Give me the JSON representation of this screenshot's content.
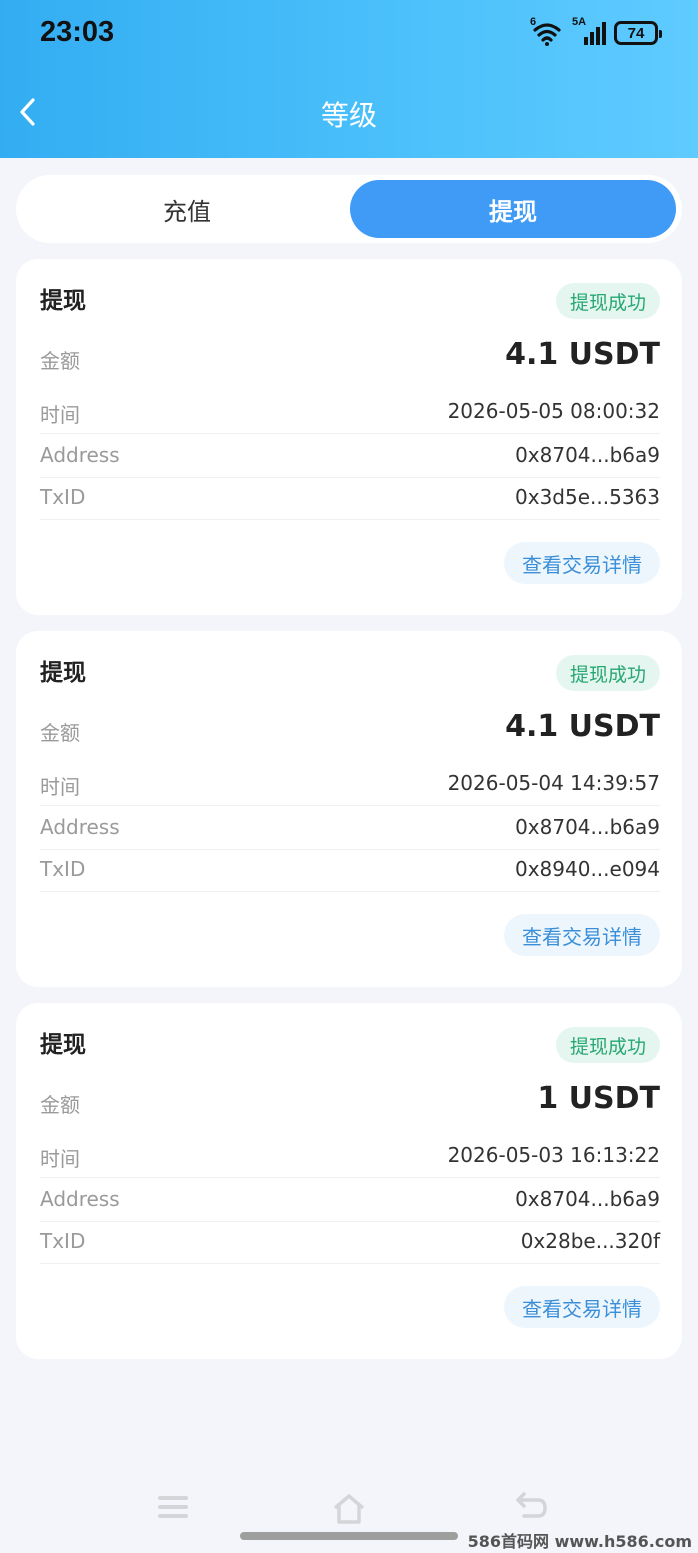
{
  "status_bar": {
    "time": "23:03",
    "wifi_badge": "6",
    "signal_badge": "5A",
    "battery": "74"
  },
  "header": {
    "title": "等级"
  },
  "tabs": [
    {
      "label": "充值",
      "active": false
    },
    {
      "label": "提现",
      "active": true
    }
  ],
  "labels": {
    "amount": "金额",
    "time": "时间",
    "address": "Address",
    "txid": "TxID",
    "details_button": "查看交易详情"
  },
  "records": [
    {
      "type": "提现",
      "status": "提现成功",
      "amount": "4.1 USDT",
      "time": "2026-05-05 08:00:32",
      "address": "0x8704...b6a9",
      "txid": "0x3d5e...5363"
    },
    {
      "type": "提现",
      "status": "提现成功",
      "amount": "4.1 USDT",
      "time": "2026-05-04 14:39:57",
      "address": "0x8704...b6a9",
      "txid": "0x8940...e094"
    },
    {
      "type": "提现",
      "status": "提现成功",
      "amount": "1 USDT",
      "time": "2026-05-03 16:13:22",
      "address": "0x8704...b6a9",
      "txid": "0x28be...320f"
    }
  ],
  "watermark": "586首码网 www.h586.com",
  "colors": {
    "header_start": "#33adf2",
    "header_end": "#5fcbff",
    "active_tab": "#3f9bf5",
    "success_text": "#28a774",
    "success_bg": "#e4f6ef",
    "link": "#3a8fd8"
  }
}
